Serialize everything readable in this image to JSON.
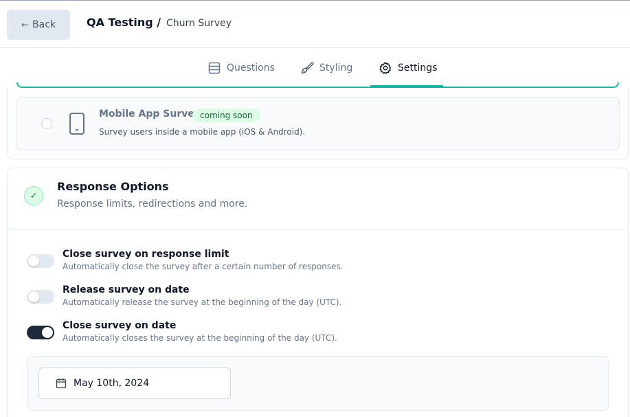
{
  "header": {
    "back_label": "Back",
    "project": "QA Testing /",
    "survey_name": "Churn Survey"
  },
  "tabs": [
    {
      "label": "Questions",
      "icon": "list-icon"
    },
    {
      "label": "Styling",
      "icon": "paintbrush-icon"
    },
    {
      "label": "Settings",
      "icon": "gear-icon",
      "active": true
    }
  ],
  "survey_type": {
    "mobile": {
      "title": "Mobile App Survey",
      "badge": "coming soon",
      "description": "Survey users inside a mobile app (iOS & Android)."
    }
  },
  "response_options": {
    "title": "Response Options",
    "description": "Response limits, redirections and more.",
    "options": [
      {
        "title": "Close survey on response limit",
        "description": "Automatically close the survey after a certain number of responses.",
        "enabled": false
      },
      {
        "title": "Release survey on date",
        "description": "Automatically release the survey at the beginning of the day (UTC).",
        "enabled": false
      },
      {
        "title": "Close survey on date",
        "description": "Automatically closes the survey at the beginning of the day (UTC).",
        "enabled": true
      }
    ],
    "close_date": "May 10th, 2024"
  },
  "colors": {
    "accent": "#14b8a6",
    "toggle_on": "#1e293b",
    "badge_bg": "#dcfce7"
  }
}
